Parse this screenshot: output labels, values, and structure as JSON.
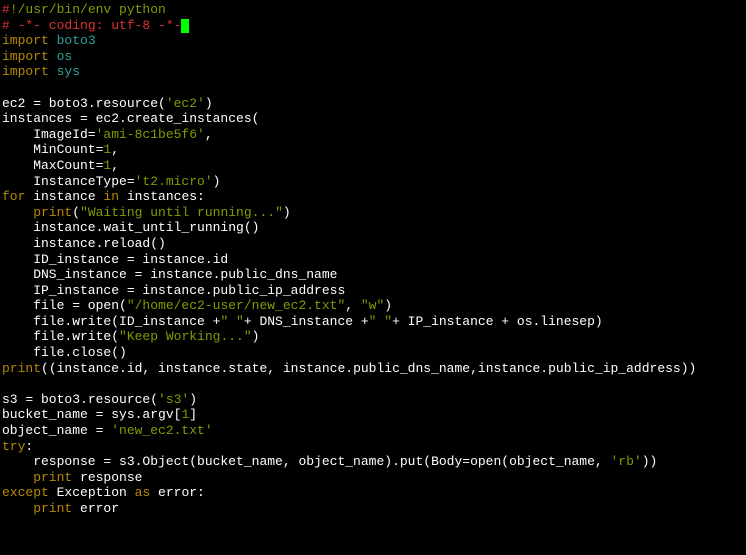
{
  "lines": [
    {
      "id": "l1",
      "segments": [
        {
          "text": "#",
          "cls": "red"
        },
        {
          "text": "!/usr/bin/env python",
          "cls": "green"
        }
      ]
    },
    {
      "id": "l2",
      "segments": [
        {
          "text": "# -*- coding: utf-8 -*-",
          "cls": "red"
        }
      ],
      "cursor": true
    },
    {
      "id": "l3",
      "segments": [
        {
          "text": "import",
          "cls": "yellow"
        },
        {
          "text": " boto3",
          "cls": "cyan"
        }
      ]
    },
    {
      "id": "l4",
      "segments": [
        {
          "text": "import",
          "cls": "yellow"
        },
        {
          "text": " os",
          "cls": "cyan"
        }
      ]
    },
    {
      "id": "l5",
      "segments": [
        {
          "text": "import",
          "cls": "yellow"
        },
        {
          "text": " sys",
          "cls": "cyan"
        }
      ]
    },
    {
      "id": "l6",
      "segments": []
    },
    {
      "id": "l7",
      "segments": [
        {
          "text": "ec2 = boto3.resource(",
          "cls": "white"
        },
        {
          "text": "'ec2'",
          "cls": "green"
        },
        {
          "text": ")",
          "cls": "white"
        }
      ]
    },
    {
      "id": "l8",
      "segments": [
        {
          "text": "instances = ec2.create_instances(",
          "cls": "white"
        }
      ]
    },
    {
      "id": "l9",
      "indent": 1,
      "segments": [
        {
          "text": "ImageId=",
          "cls": "white"
        },
        {
          "text": "'ami-8c1be5f6'",
          "cls": "green"
        },
        {
          "text": ",",
          "cls": "white"
        }
      ]
    },
    {
      "id": "l10",
      "indent": 1,
      "segments": [
        {
          "text": "MinCount=",
          "cls": "white"
        },
        {
          "text": "1",
          "cls": "green"
        },
        {
          "text": ",",
          "cls": "white"
        }
      ]
    },
    {
      "id": "l11",
      "indent": 1,
      "segments": [
        {
          "text": "MaxCount=",
          "cls": "white"
        },
        {
          "text": "1",
          "cls": "green"
        },
        {
          "text": ",",
          "cls": "white"
        }
      ]
    },
    {
      "id": "l12",
      "indent": 1,
      "segments": [
        {
          "text": "InstanceType=",
          "cls": "white"
        },
        {
          "text": "'t2.micro'",
          "cls": "green"
        },
        {
          "text": ")",
          "cls": "white"
        }
      ]
    },
    {
      "id": "l13",
      "segments": [
        {
          "text": "for",
          "cls": "yellow"
        },
        {
          "text": " instance ",
          "cls": "white"
        },
        {
          "text": "in",
          "cls": "yellow"
        },
        {
          "text": " instances:",
          "cls": "white"
        }
      ]
    },
    {
      "id": "l14",
      "indent": 1,
      "segments": [
        {
          "text": "print",
          "cls": "yellow"
        },
        {
          "text": "(",
          "cls": "white"
        },
        {
          "text": "\"Waiting until running...\"",
          "cls": "green"
        },
        {
          "text": ")",
          "cls": "white"
        }
      ]
    },
    {
      "id": "l15",
      "indent": 1,
      "segments": [
        {
          "text": "instance.wait_until_running()",
          "cls": "white"
        }
      ]
    },
    {
      "id": "l16",
      "indent": 1,
      "segments": [
        {
          "text": "instance.reload()",
          "cls": "white"
        }
      ]
    },
    {
      "id": "l17",
      "indent": 1,
      "segments": [
        {
          "text": "ID_instance = instance.id",
          "cls": "white"
        }
      ]
    },
    {
      "id": "l18",
      "indent": 1,
      "segments": [
        {
          "text": "DNS_instance = instance.public_dns_name",
          "cls": "white"
        }
      ]
    },
    {
      "id": "l19",
      "indent": 1,
      "segments": [
        {
          "text": "IP_instance = instance.public_ip_address",
          "cls": "white"
        }
      ]
    },
    {
      "id": "l20",
      "indent": 1,
      "segments": [
        {
          "text": "file = open(",
          "cls": "white"
        },
        {
          "text": "\"/home/ec2-user/new_ec2.txt\"",
          "cls": "green"
        },
        {
          "text": ", ",
          "cls": "white"
        },
        {
          "text": "\"w\"",
          "cls": "green"
        },
        {
          "text": ")",
          "cls": "white"
        }
      ]
    },
    {
      "id": "l21",
      "indent": 1,
      "segments": [
        {
          "text": "file.write(ID_instance +",
          "cls": "white"
        },
        {
          "text": "\" \"",
          "cls": "green"
        },
        {
          "text": "+ DNS_instance +",
          "cls": "white"
        },
        {
          "text": "\" \"",
          "cls": "green"
        },
        {
          "text": "+ IP_instance + os.linesep)",
          "cls": "white"
        }
      ]
    },
    {
      "id": "l22",
      "indent": 1,
      "segments": [
        {
          "text": "file.write(",
          "cls": "white"
        },
        {
          "text": "\"Keep Working...\"",
          "cls": "green"
        },
        {
          "text": ")",
          "cls": "white"
        }
      ]
    },
    {
      "id": "l23",
      "indent": 1,
      "segments": [
        {
          "text": "file.close()",
          "cls": "white"
        }
      ]
    },
    {
      "id": "l24",
      "segments": [
        {
          "text": "print",
          "cls": "yellow"
        },
        {
          "text": "((instance.id, instance.state, instance.public_dns_name,instance.public_ip_address))",
          "cls": "white"
        }
      ]
    },
    {
      "id": "l25",
      "segments": []
    },
    {
      "id": "l26",
      "segments": [
        {
          "text": "s3 = boto3.resource(",
          "cls": "white"
        },
        {
          "text": "'s3'",
          "cls": "green"
        },
        {
          "text": ")",
          "cls": "white"
        }
      ]
    },
    {
      "id": "l27",
      "segments": [
        {
          "text": "bucket_name = sys.argv[",
          "cls": "white"
        },
        {
          "text": "1",
          "cls": "green"
        },
        {
          "text": "]",
          "cls": "white"
        }
      ]
    },
    {
      "id": "l28",
      "segments": [
        {
          "text": "object_name = ",
          "cls": "white"
        },
        {
          "text": "'new_ec2.txt'",
          "cls": "green"
        }
      ]
    },
    {
      "id": "l29",
      "segments": [
        {
          "text": "try",
          "cls": "yellow"
        },
        {
          "text": ":",
          "cls": "white"
        }
      ]
    },
    {
      "id": "l30",
      "indent": 1,
      "segments": [
        {
          "text": "response = s3.Object(bucket_name, object_name).put(Body=open(object_name, ",
          "cls": "white"
        },
        {
          "text": "'rb'",
          "cls": "green"
        },
        {
          "text": "))",
          "cls": "white"
        }
      ]
    },
    {
      "id": "l31",
      "indent": 1,
      "segments": [
        {
          "text": "print",
          "cls": "yellow"
        },
        {
          "text": " response",
          "cls": "white"
        }
      ]
    },
    {
      "id": "l32",
      "segments": [
        {
          "text": "except",
          "cls": "yellow"
        },
        {
          "text": " Exception ",
          "cls": "white"
        },
        {
          "text": "as",
          "cls": "yellow"
        },
        {
          "text": " error:",
          "cls": "white"
        }
      ]
    },
    {
      "id": "l33",
      "indent": 1,
      "segments": [
        {
          "text": "print",
          "cls": "yellow"
        },
        {
          "text": " error",
          "cls": "white"
        }
      ]
    }
  ]
}
